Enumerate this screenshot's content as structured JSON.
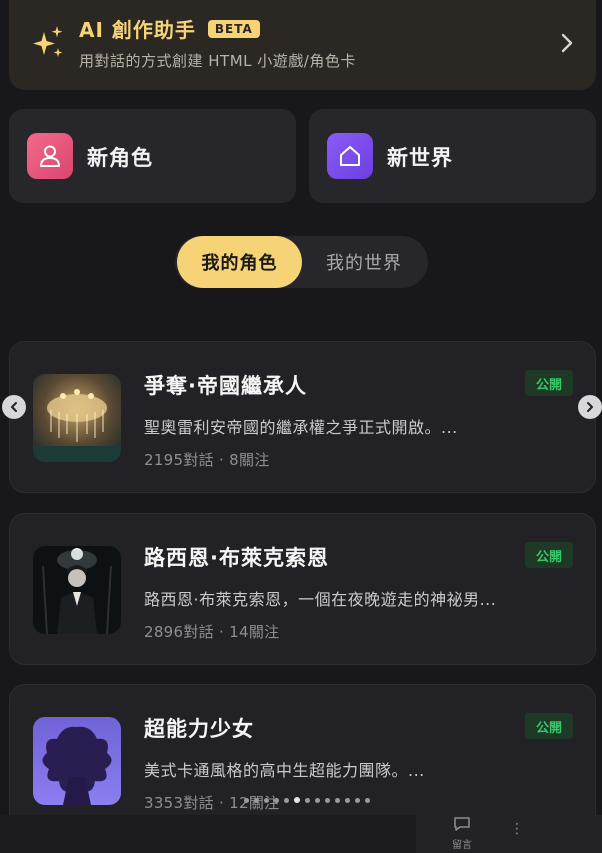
{
  "ai_banner": {
    "title": "AI 創作助手",
    "badge": "BETA",
    "subtitle": "用對話的方式創建 HTML 小遊戲/角色卡",
    "icon": "sparkles-icon"
  },
  "create": {
    "character_label": "新角色",
    "world_label": "新世界",
    "character_icon": "user-icon",
    "world_icon": "home-icon"
  },
  "tabs": {
    "my_characters": "我的角色",
    "my_worlds": "我的世界",
    "active": "我的角色"
  },
  "characters": [
    {
      "name": "爭奪·帝國繼承人",
      "badge": "公開",
      "description": "聖奧雷利安帝國的繼承權之爭正式開啟。...",
      "stats": "2195對話 · 8關注"
    },
    {
      "name": "路西恩·布萊克索恩",
      "badge": "公開",
      "description": "路西恩·布萊克索恩，一個在夜晚遊走的神祕男...",
      "stats": "2896對話 · 14關注"
    },
    {
      "name": "超能力少女",
      "badge": "公開",
      "description": "美式卡通風格的高中生超能力團隊。...",
      "stats": "3353對話 · 12關注"
    }
  ],
  "pagination": {
    "count": 13,
    "active_index": 5
  },
  "bottom_bar": {
    "comment_label": "留言"
  },
  "colors": {
    "background": "#18181b",
    "accent_gold": "#f7d377",
    "public_green": "#38c86a",
    "pink": "#e8557a",
    "purple": "#7c4dee"
  }
}
